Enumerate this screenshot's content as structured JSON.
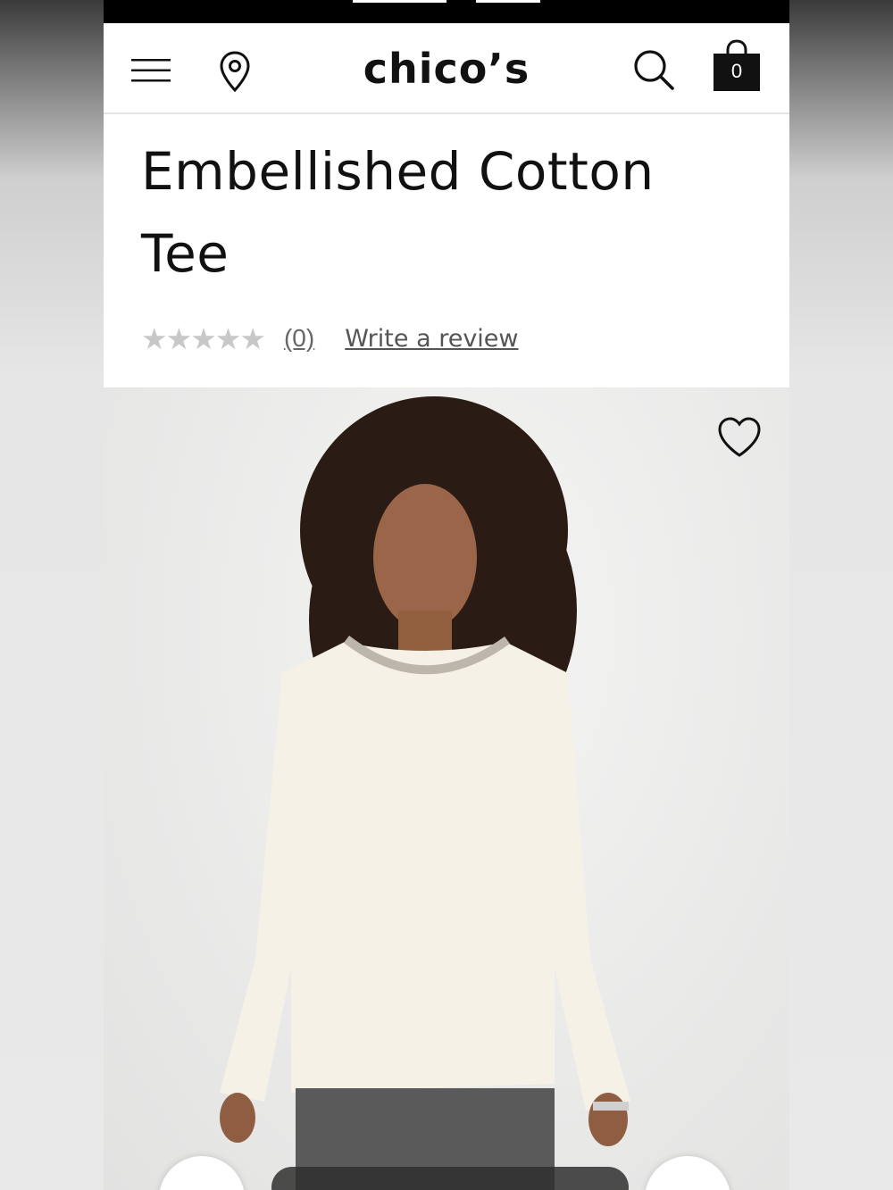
{
  "header": {
    "brand": "chico’s",
    "bag_count": "0",
    "icons": [
      "menu-icon",
      "location-pin-icon",
      "search-icon",
      "shopping-bag-icon"
    ]
  },
  "product": {
    "title_line1": "Embellished Cotton",
    "title_line2": "Tee",
    "rating_value": 0,
    "rating_max": 5,
    "review_count_label": "(0)",
    "write_review_label": "Write a review"
  },
  "image": {
    "alt": "Model wearing ivory long-sleeve tee with embellished neckline",
    "favorite_icon": "heart-icon"
  },
  "colors": {
    "top_bar": "#000000",
    "text": "#111111",
    "star_empty": "#c8c8c8",
    "link": "#555555"
  }
}
